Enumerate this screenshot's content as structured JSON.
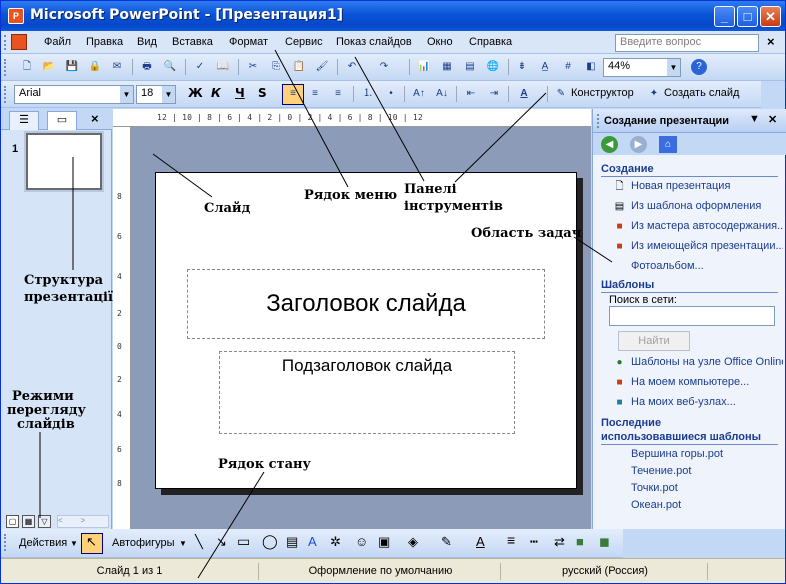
{
  "window": {
    "title": "Microsoft PowerPoint - [Презентация1]",
    "minimize_glyph": "_",
    "maximize_glyph": "□",
    "close_glyph": "✕"
  },
  "menu": {
    "items": [
      "Файл",
      "Правка",
      "Вид",
      "Вставка",
      "Формат",
      "Сервис",
      "Показ слайдов",
      "Окно",
      "Справка"
    ],
    "ask_placeholder": "Введите вопрос",
    "close_glyph": "×"
  },
  "standard_toolbar": {
    "zoom": "44%"
  },
  "format_toolbar": {
    "font": "Arial",
    "font_size": "18",
    "bold": "Ж",
    "italic": "К",
    "underline": "Ч",
    "shadow": "S",
    "designer": "Конструктор",
    "new_slide": "Создать слайд"
  },
  "left_pane": {
    "slide_number": "1",
    "close_glyph": "×"
  },
  "ruler": {
    "top": "12 | 10 | 8 | 6 | 4 | 2 | 0 | 2 | 4 | 6 | 8 | 10 | 12",
    "left_ticks": [
      "8",
      "6",
      "4",
      "2",
      "0",
      "2",
      "4",
      "6",
      "8"
    ]
  },
  "slide": {
    "title_placeholder": "Заголовок слайда",
    "subtitle_placeholder": "Подзаголовок слайда"
  },
  "task_pane": {
    "title": "Создание презентации",
    "sections": {
      "create": {
        "title": "Создание",
        "links": [
          "Новая презентация",
          "Из шаблона оформления",
          "Из мастера автосодержания...",
          "Из имеющейся презентации...",
          "Фотоальбом..."
        ]
      },
      "templates": {
        "title": "Шаблоны",
        "search_label": "Поиск в сети:",
        "find_button": "Найти",
        "links": [
          "Шаблоны на узле Office Online",
          "На моем компьютере...",
          "На моих веб-узлах..."
        ]
      },
      "recent": {
        "title": "Последние использовавшиеся шаблоны",
        "title_line1": "Последние",
        "title_line2": "использовавшиеся шаблоны",
        "items": [
          "Вершина горы.pot",
          "Течение.pot",
          "Точки.pot",
          "Океан.pot"
        ]
      }
    }
  },
  "drawing_toolbar": {
    "actions": "Действия",
    "autoshapes": "Автофигуры"
  },
  "status_bar": {
    "slide_info": "Слайд 1 из 1",
    "design": "Оформление по умолчанию",
    "language": "русский (Россия)"
  },
  "annotations": {
    "slide": "Слайд",
    "menu_bar": "Рядок меню",
    "toolbars_line1": "Панелі",
    "toolbars_line2": "інструментів",
    "task_pane": "Область задач",
    "structure_line1": "Структура",
    "structure_line2": "презентації",
    "views_line1": "Режими",
    "views_line2": "перегляду",
    "views_line3": "слайдів",
    "status_bar": "Рядок стану"
  }
}
